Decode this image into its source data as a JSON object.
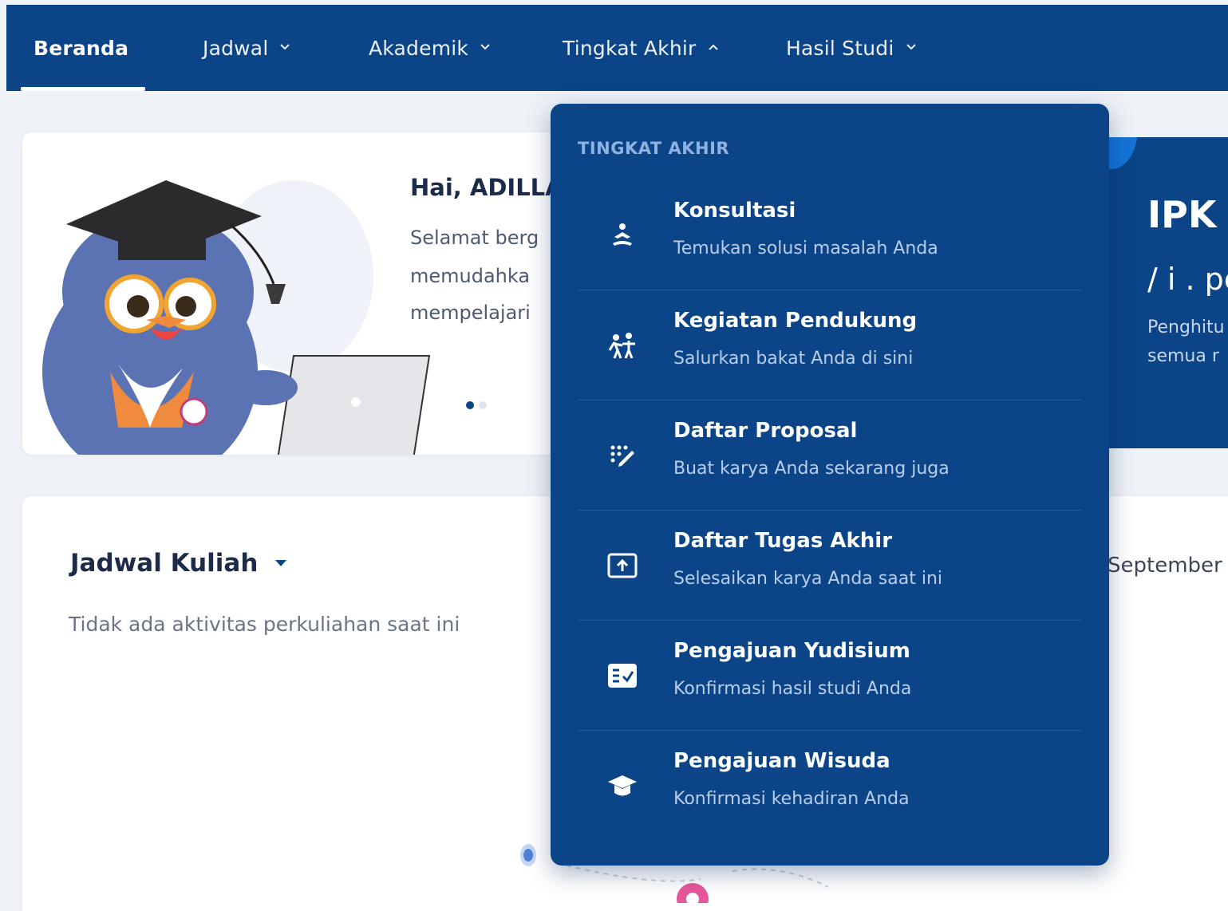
{
  "nav": {
    "items": [
      {
        "label": "Beranda",
        "active": true,
        "chevron": ""
      },
      {
        "label": "Jadwal",
        "chevron": "chevron-down"
      },
      {
        "label": "Akademik",
        "chevron": "chevron-down"
      },
      {
        "label": "Tingkat Akhir",
        "chevron": "chevron-up"
      },
      {
        "label": "Hasil Studi",
        "chevron": "chevron-down"
      }
    ]
  },
  "hero": {
    "title": "Hai, ADILLA",
    "lines": [
      "Selamat berg",
      "memudahka",
      "mempelajari"
    ]
  },
  "ipk": {
    "title": "IPK",
    "value": "/ i . pe",
    "desc": [
      "Penghitu",
      "semua r"
    ]
  },
  "jadwal": {
    "title": "Jadwal Kuliah",
    "empty": "Tidak ada aktivitas perkuliahan saat ini",
    "date": "September"
  },
  "dropdown": {
    "heading": "TINGKAT AKHIR",
    "items": [
      {
        "title": "Konsultasi",
        "subtitle": "Temukan solusi masalah Anda",
        "icon": "meditation-icon"
      },
      {
        "title": "Kegiatan Pendukung",
        "subtitle": "Salurkan bakat Anda di sini",
        "icon": "people-activity-icon"
      },
      {
        "title": "Daftar Proposal",
        "subtitle": "Buat karya Anda sekarang juga",
        "icon": "pencil-dots-icon"
      },
      {
        "title": "Daftar Tugas Akhir",
        "subtitle": "Selesaikan karya Anda saat ini",
        "icon": "upload-box-icon"
      },
      {
        "title": "Pengajuan Yudisium",
        "subtitle": "Konfirmasi hasil studi Anda",
        "icon": "checklist-icon"
      },
      {
        "title": "Pengajuan Wisuda",
        "subtitle": "Konfirmasi kehadiran Anda",
        "icon": "graduation-cap-icon"
      }
    ]
  },
  "colors": {
    "primary": "#0b4588",
    "accent": "#1573d6",
    "background": "#eef2f7"
  }
}
